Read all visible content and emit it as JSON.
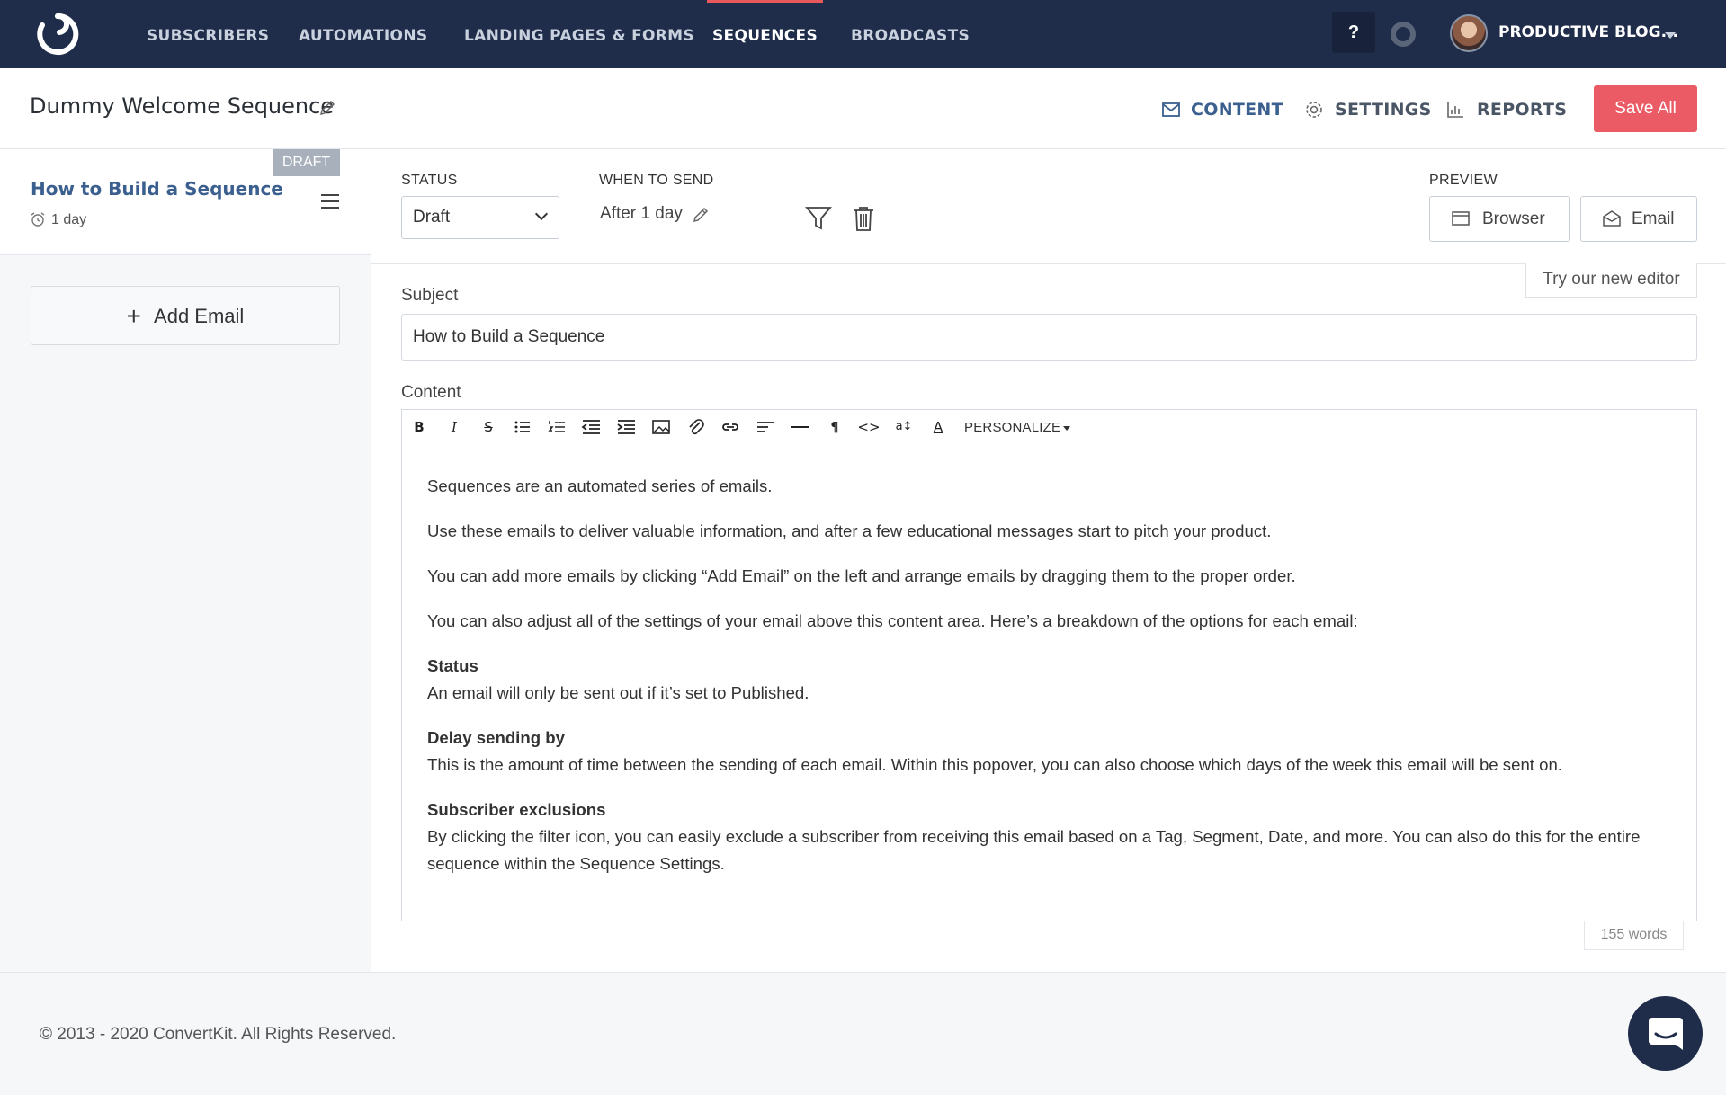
{
  "nav": {
    "items": [
      "SUBSCRIBERS",
      "AUTOMATIONS",
      "LANDING PAGES & FORMS",
      "SEQUENCES",
      "BROADCASTS"
    ],
    "help": "?",
    "account": "PRODUCTIVE BLOG..."
  },
  "header": {
    "title": "Dummy Welcome Sequence",
    "tabs": {
      "content": "CONTENT",
      "settings": "SETTINGS",
      "reports": "REPORTS"
    },
    "save": "Save All"
  },
  "sidebar": {
    "badge": "DRAFT",
    "email_name": "How to Build a Sequence",
    "delay": "1 day",
    "add_email": "Add Email"
  },
  "email_settings": {
    "status_label": "STATUS",
    "status_value": "Draft",
    "when_label": "WHEN TO SEND",
    "when_value": "After 1 day",
    "preview_label": "PREVIEW",
    "preview_browser": "Browser",
    "preview_email": "Email"
  },
  "editor": {
    "try_new": "Try our new editor",
    "subject_label": "Subject",
    "subject_value": "How to Build a Sequence",
    "content_label": "Content",
    "personalize": "PERSONALIZE",
    "p1": "Sequences are an automated series of emails.",
    "p2": "Use these emails to deliver valuable information, and after a few educational messages start to pitch your product.",
    "p3": "You can add more emails by clicking “Add Email” on the left and arrange emails by dragging them to the proper order.",
    "p4": "You can also adjust all of the settings of your email above this content area. Here’s a breakdown of the options for each email:",
    "h1": "Status",
    "t1": "An email will only be sent out if it’s set to Published.",
    "h2": "Delay sending by",
    "t2": "This is the amount of time between the sending of each email. Within this popover, you can also choose which days of the week this email will be sent on.",
    "h3": "Subscriber exclusions",
    "t3": "By clicking the filter icon, you can easily exclude a subscriber from receiving this email based on a Tag, Segment, Date, and more. You can also do this for the entire sequence within the Sequence Settings.",
    "word_count": "155 words"
  },
  "footer": {
    "copyright": "© 2013 - 2020 ConvertKit. All Rights Reserved."
  },
  "colors": {
    "nav_bg": "#1f2d4a",
    "accent": "#ea5b66",
    "link": "#3b5f8e"
  }
}
